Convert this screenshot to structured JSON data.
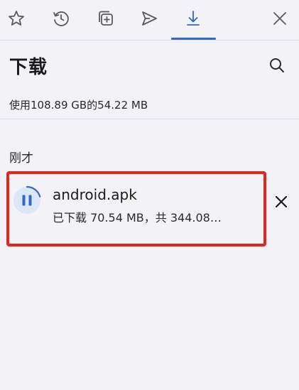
{
  "tabs": [
    {
      "id": "favorites",
      "icon": "star-icon"
    },
    {
      "id": "history",
      "icon": "history-icon"
    },
    {
      "id": "collections",
      "icon": "collections-icon"
    },
    {
      "id": "share",
      "icon": "send-icon"
    },
    {
      "id": "downloads",
      "icon": "download-icon",
      "active": true
    },
    {
      "id": "close",
      "icon": "close-icon"
    }
  ],
  "accent_color": "#3168c9",
  "highlight_color": "#e8231c",
  "header": {
    "title": "下载",
    "search_icon": "search-icon"
  },
  "storage": {
    "text": "使用108.89 GB的54.22 MB"
  },
  "sections": [
    {
      "header": "刚才",
      "items": [
        {
          "file_name": "android.apk",
          "status": "已下载 70.54 MB，共 344.08…",
          "downloaded_mb": 70.54,
          "total_mb": 344.08,
          "state": "paused",
          "action_icon": "pause-icon",
          "remove_icon": "close-icon"
        }
      ]
    }
  ]
}
